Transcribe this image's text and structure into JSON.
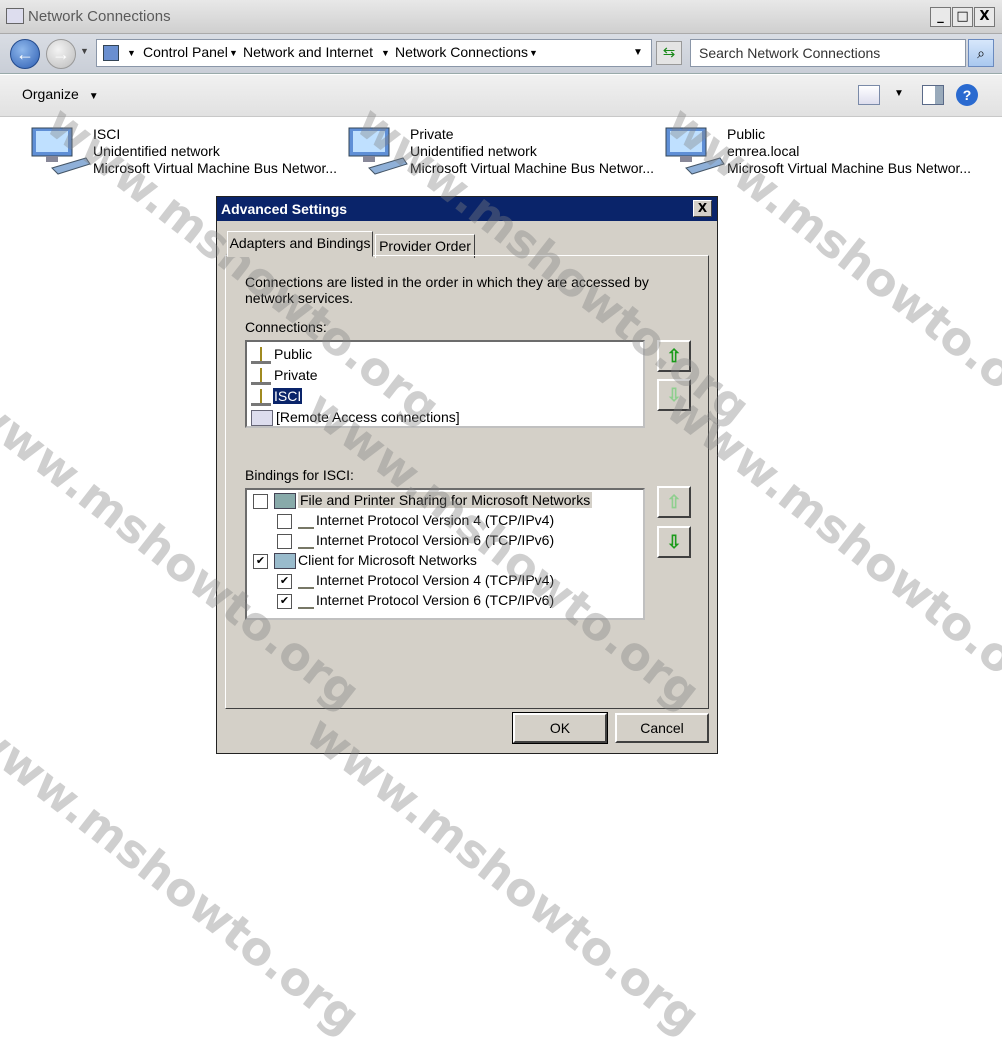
{
  "window": {
    "title": "Network Connections",
    "controls": [
      "_",
      "□",
      "X"
    ]
  },
  "address": {
    "crumbs": [
      "Control Panel",
      "Network and Internet",
      "Network Connections"
    ],
    "search_placeholder": "Search Network Connections"
  },
  "toolbar": {
    "organize_label": "Organize",
    "organize_arrow": "▼"
  },
  "connections": [
    {
      "name": "ISCI",
      "status": "Unidentified network",
      "adapter": "Microsoft Virtual Machine Bus Networ..."
    },
    {
      "name": "Private",
      "status": "Unidentified network",
      "adapter": "Microsoft Virtual Machine Bus Networ..."
    },
    {
      "name": "Public",
      "status": "emrea.local",
      "adapter": "Microsoft Virtual Machine Bus Networ..."
    }
  ],
  "dialog": {
    "title": "Advanced Settings",
    "close": "X",
    "tabs": [
      "Adapters and Bindings",
      "Provider Order"
    ],
    "intro": [
      "Connections are listed in the order in which they are accessed by",
      "network services."
    ],
    "connections_label": "Connections:",
    "connections_list": [
      "Public",
      "Private",
      "ISCI",
      "[Remote Access connections]"
    ],
    "selected_connection": "ISCI",
    "bindings_label": "Bindings for ISCI:",
    "bindings": [
      {
        "label": "File and Printer Sharing for Microsoft Networks",
        "checked": false,
        "level": 0
      },
      {
        "label": "Internet Protocol Version 4 (TCP/IPv4)",
        "checked": false,
        "level": 1
      },
      {
        "label": "Internet Protocol Version 6 (TCP/IPv6)",
        "checked": false,
        "level": 1
      },
      {
        "label": "Client for Microsoft Networks",
        "checked": true,
        "level": 0
      },
      {
        "label": "Internet Protocol Version 4 (TCP/IPv4)",
        "checked": true,
        "level": 1
      },
      {
        "label": "Internet Protocol Version 6 (TCP/IPv6)",
        "checked": true,
        "level": 1
      }
    ],
    "ok_label": "OK",
    "cancel_label": "Cancel"
  },
  "watermark": "www.mshowto.org",
  "colors": {
    "dialog_title": "#0a246a",
    "dialog_face": "#d4d0c8",
    "selection": "#0a246a",
    "arrow_green": "#1b9b1b"
  }
}
